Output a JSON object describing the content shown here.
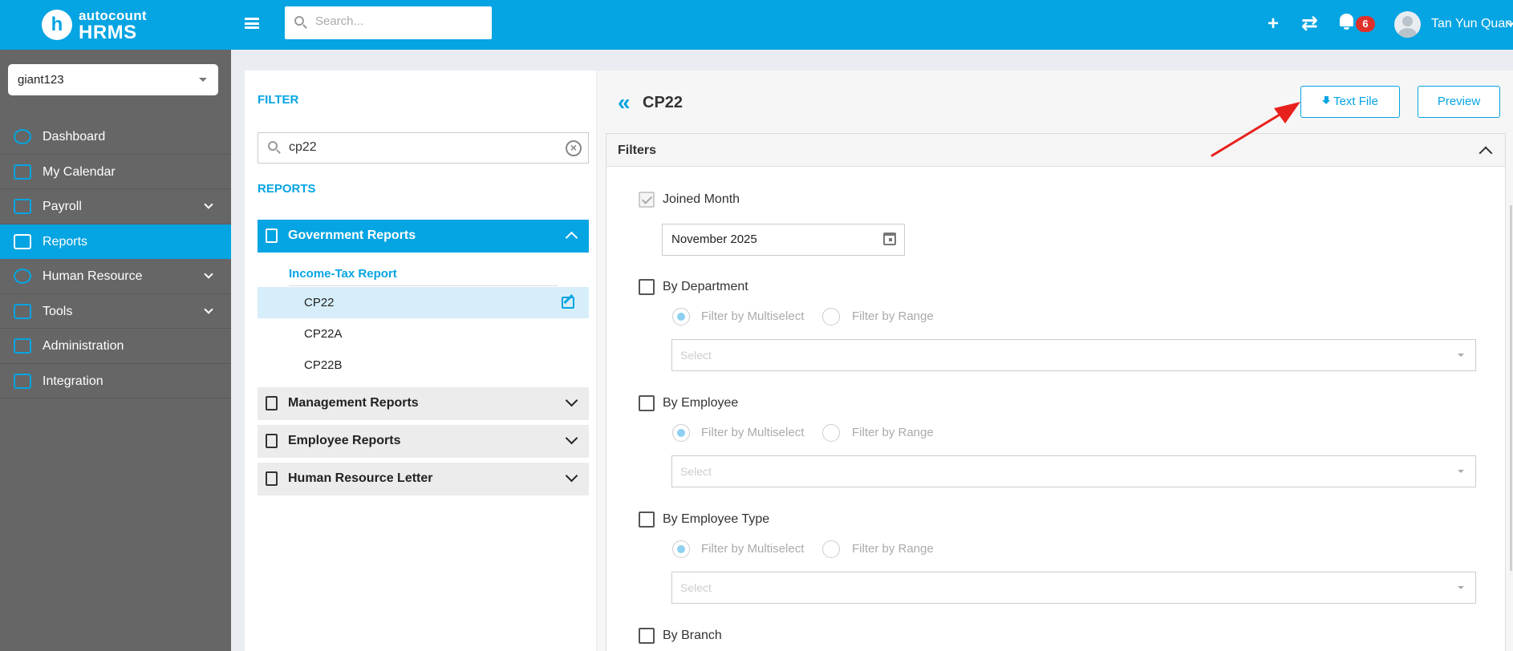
{
  "app": {
    "logo_letter": "h",
    "brand": "autocount",
    "product": "HRMS"
  },
  "company_select": {
    "value": "giant123"
  },
  "sidebar": {
    "items": [
      {
        "label": "Dashboard",
        "icon": "dashboard-icon"
      },
      {
        "label": "My Calendar",
        "icon": "calendar-icon"
      },
      {
        "label": "Payroll",
        "icon": "payroll-icon",
        "expandable": true
      },
      {
        "label": "Reports",
        "icon": "reports-icon",
        "active": true
      },
      {
        "label": "Human Resource",
        "icon": "human-resource-icon",
        "expandable": true
      },
      {
        "label": "Tools",
        "icon": "tools-icon",
        "expandable": true
      },
      {
        "label": "Administration",
        "icon": "administration-icon"
      },
      {
        "label": "Integration",
        "icon": "integration-icon"
      }
    ]
  },
  "topbar": {
    "search_placeholder": "Search...",
    "plus": "+",
    "sync": "⇄",
    "notification_count": "6",
    "user_name": "Tan Yun Quan"
  },
  "report_panel": {
    "filter_label": "FILTER",
    "filter_value": "cp22",
    "clear_symbol": "×",
    "reports_label": "REPORTS",
    "groups": [
      {
        "label": "Government Reports",
        "open": true
      },
      {
        "label": "Management Reports"
      },
      {
        "label": "Employee Reports"
      },
      {
        "label": "Human Resource Letter"
      }
    ],
    "subgroup": "Income-Tax Report",
    "items": [
      "CP22",
      "CP22A",
      "CP22B"
    ],
    "selected_item": "CP22"
  },
  "main": {
    "back_symbol": "«",
    "title": "CP22",
    "text_file_label": "Text File",
    "preview_label": "Preview",
    "filters_title": "Filters",
    "joined_month": {
      "label": "Joined Month",
      "checked": true,
      "value": "November 2025"
    },
    "radio_multiselect": "Filter by Multiselect",
    "radio_range": "Filter by Range",
    "select_placeholder": "Select",
    "filter_groups": [
      {
        "label": "By Department"
      },
      {
        "label": "By Employee"
      },
      {
        "label": "By Employee Type"
      },
      {
        "label": "By Branch"
      }
    ]
  },
  "colors": {
    "primary": "#05a4e2",
    "sidebar_bg": "#666666",
    "badge": "#e0302b",
    "annotation_arrow": "#e8201c"
  }
}
